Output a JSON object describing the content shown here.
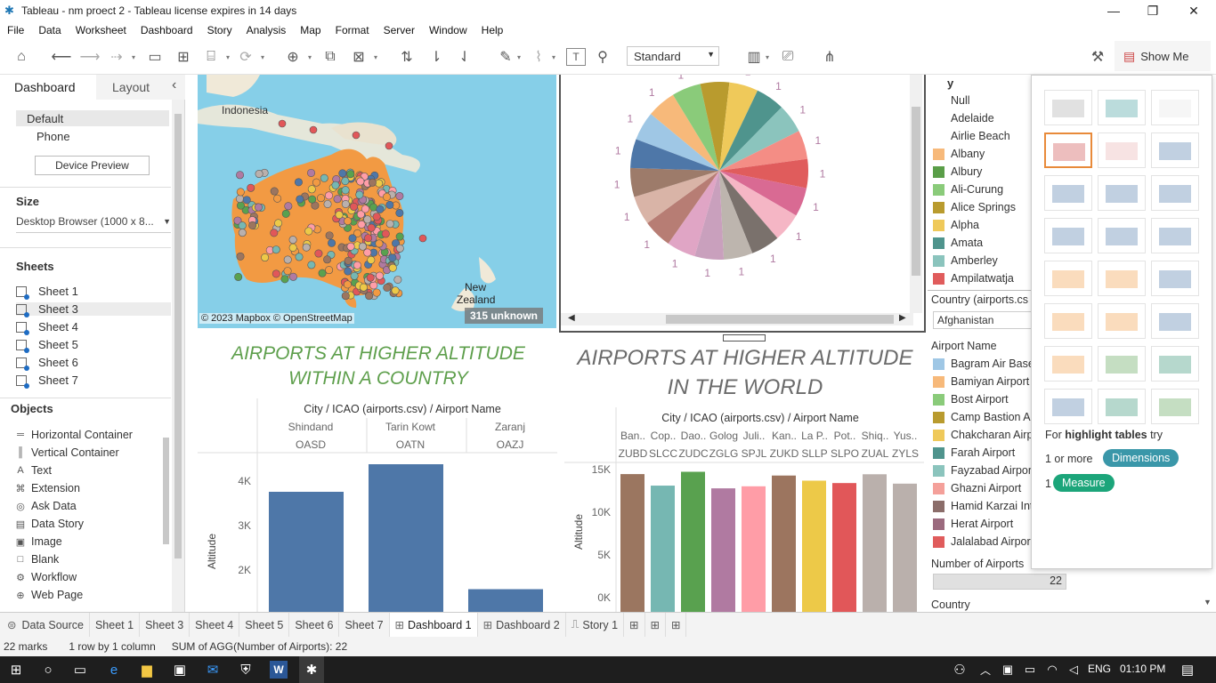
{
  "window": {
    "title": "Tableau - nm proect 2 - Tableau license expires in 14 days"
  },
  "menu": [
    "File",
    "Data",
    "Worksheet",
    "Dashboard",
    "Story",
    "Analysis",
    "Map",
    "Format",
    "Server",
    "Window",
    "Help"
  ],
  "toolbar": {
    "fit_select": "Standard",
    "show_me": "Show Me"
  },
  "left": {
    "tab_dashboard": "Dashboard",
    "tab_layout": "Layout",
    "collapse": "‹",
    "device_default": "Default",
    "device_phone": "Phone",
    "device_preview": "Device Preview",
    "size_header": "Size",
    "size_value": "Desktop Browser (1000 x 8...",
    "sheets_header": "Sheets",
    "sheets": [
      "Sheet 1",
      "Sheet 3",
      "Sheet 4",
      "Sheet 5",
      "Sheet 6",
      "Sheet 7"
    ],
    "objects_header": "Objects",
    "objects": [
      {
        "label": "Horizontal Container",
        "icon": "horizontal-container-icon",
        "glyph": "═"
      },
      {
        "label": "Vertical Container",
        "icon": "vertical-container-icon",
        "glyph": "║"
      },
      {
        "label": "Text",
        "icon": "text-icon",
        "glyph": "A"
      },
      {
        "label": "Extension",
        "icon": "extension-icon",
        "glyph": "⌘"
      },
      {
        "label": "Ask Data",
        "icon": "ask-data-icon",
        "glyph": "◎"
      },
      {
        "label": "Data Story",
        "icon": "data-story-icon",
        "glyph": "▤"
      },
      {
        "label": "Image",
        "icon": "image-icon",
        "glyph": "▣"
      },
      {
        "label": "Blank",
        "icon": "blank-icon",
        "glyph": "□"
      },
      {
        "label": "Workflow",
        "icon": "workflow-icon",
        "glyph": "⚙"
      },
      {
        "label": "Web Page",
        "icon": "web-page-icon",
        "glyph": "⊕"
      }
    ]
  },
  "map": {
    "label_indonesia": "Indonesia",
    "label_nz_line1": "New",
    "label_nz_line2": "Zealand",
    "attribution": "© 2023 Mapbox © OpenStreetMap",
    "unknown": "315 unknown"
  },
  "pie": {
    "slice_label": "1",
    "slices": [
      "#9fc7e5",
      "#f7b97a",
      "#8acb7a",
      "#b99b2e",
      "#efc95a",
      "#4f948d",
      "#8bc4bd",
      "#f48d85",
      "#e05c5c",
      "#d96a93",
      "#f5b6c5",
      "#7a716c",
      "#bdb5ae",
      "#c9a0bd",
      "#e0a5c5",
      "#b77d74",
      "#d9b4a7",
      "#9d7b6a",
      "#4e77a8"
    ]
  },
  "legend": {
    "head": "y",
    "cities": [
      {
        "name": "Null",
        "color": ""
      },
      {
        "name": "Adelaide",
        "color": ""
      },
      {
        "name": "Airlie Beach",
        "color": ""
      },
      {
        "name": "Albany",
        "color": "#f7b97a"
      },
      {
        "name": "Albury",
        "color": "#5a9e48"
      },
      {
        "name": "Ali-Curung",
        "color": "#8acb7a"
      },
      {
        "name": "Alice Springs",
        "color": "#b99b2e"
      },
      {
        "name": "Alpha",
        "color": "#efc95a"
      },
      {
        "name": "Amata",
        "color": "#4f948d"
      },
      {
        "name": "Amberley",
        "color": "#8bc4bd"
      },
      {
        "name": "Ampilatwatja",
        "color": "#e05c5c"
      }
    ],
    "country_filter_label": "Country (airports.cs",
    "country_filter_value": "Afghanistan",
    "airport_header": "Airport Name",
    "airports": [
      {
        "name": "Bagram Air Base",
        "color": "#9fc7e5"
      },
      {
        "name": "Bamiyan Airport",
        "color": "#f7b97a"
      },
      {
        "name": "Bost Airport",
        "color": "#8acb7a"
      },
      {
        "name": "Camp Bastion Ai",
        "color": "#b99b2e"
      },
      {
        "name": "Chakcharan Airp",
        "color": "#efc95a"
      },
      {
        "name": "Farah Airport",
        "color": "#4f948d"
      },
      {
        "name": "Fayzabad Airport",
        "color": "#8bc4bd"
      },
      {
        "name": "Ghazni Airport",
        "color": "#f4a09a"
      },
      {
        "name": "Hamid Karzai Int",
        "color": "#8b6d6a"
      },
      {
        "name": "Herat Airport",
        "color": "#9b6a7e"
      },
      {
        "name": "Jalalabad Airpor",
        "color": "#e05c5c"
      }
    ],
    "num_airports_label": "Number of Airports",
    "num_airports_value": "22",
    "country_label2": "Country (airports.csv)"
  },
  "showme": {
    "hint_prefix": "For ",
    "hint_bold": "highlight tables",
    "hint_suffix": " try",
    "dim_prefix": "1 or more",
    "dim_pill": "Dimensions",
    "meas_prefix": "1",
    "meas_pill": "Measure"
  },
  "chart_titles": {
    "left": "AIRPORTS AT HIGHER ALTITUDE WITHIN A COUNTRY",
    "right": "AIRPORTS AT HIGHER ALTITUDE IN THE WORLD"
  },
  "chart_data": [
    {
      "type": "bar",
      "header": "City / ICAO (airports.csv) / Airport Name",
      "categories": [
        "Shindand",
        "Tarin Kowt",
        "Zaranj"
      ],
      "icao": [
        "OASD",
        "OATN",
        "OAZJ"
      ],
      "values": [
        3760,
        4380,
        1570
      ],
      "ylabel": "Altitude",
      "ticks": [
        "2K",
        "3K",
        "4K"
      ],
      "color": "#4e77a8"
    },
    {
      "type": "bar",
      "header": "City / ICAO (airports.csv) / Airport Name",
      "categories": [
        "Ban..",
        "Cop..",
        "Dao..",
        "Golog",
        "Juli..",
        "Kan..",
        "La P..",
        "Pot..",
        "Shiq..",
        "Yus.."
      ],
      "icao": [
        "ZUBD",
        "SLCC",
        "ZUDC",
        "ZGLG",
        "SPJL",
        "ZUKD",
        "SLLP",
        "SLPO",
        "ZUAL",
        "ZYLS"
      ],
      "values": [
        14470,
        13120,
        14740,
        12800,
        13040,
        14300,
        13700,
        13420,
        14450,
        13350
      ],
      "ylabel": "Altitude",
      "ticks": [
        "0K",
        "5K",
        "10K",
        "15K"
      ],
      "colors": [
        "#9b7660",
        "#76b7b2",
        "#59a14f",
        "#b07aa1",
        "#ff9da7",
        "#9c755f",
        "#edc948",
        "#e15759",
        "#bab0ac",
        "#bab0ac"
      ]
    }
  ],
  "tabs": [
    "Data Source",
    "Sheet 1",
    "Sheet 3",
    "Sheet 4",
    "Sheet 5",
    "Sheet 6",
    "Sheet 7",
    "Dashboard 1",
    "Dashboard 2",
    "Story 1"
  ],
  "status": {
    "marks": "22 marks",
    "rows": "1 row by 1 column",
    "sum": "SUM of AGG(Number of Airports): 22"
  },
  "taskbar": {
    "lang": "ENG",
    "time": "01:10 PM"
  }
}
